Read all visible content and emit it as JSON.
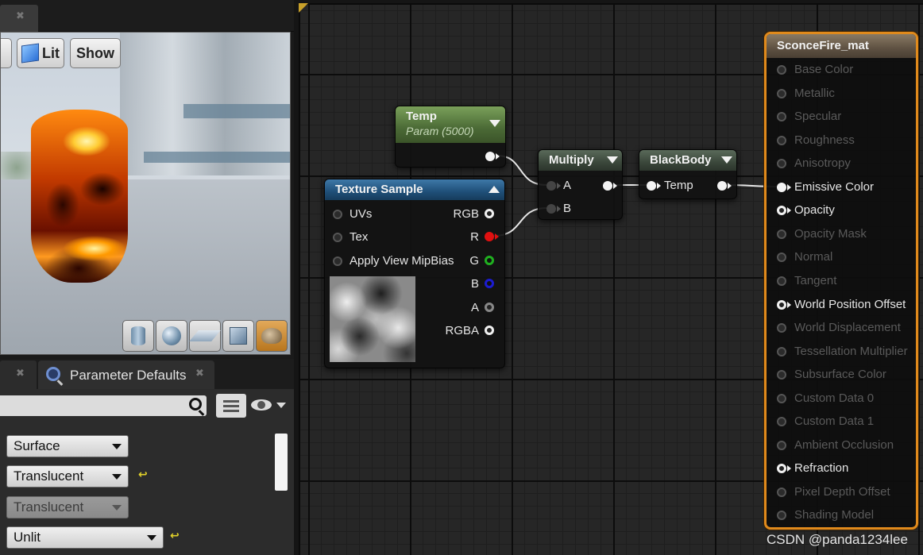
{
  "viewport": {
    "lit_label": "Lit",
    "show_label": "Show"
  },
  "panel": {
    "tab_title": "Parameter Defaults",
    "dropdowns": [
      "Surface",
      "Translucent",
      "Translucent",
      "Unlit"
    ]
  },
  "nodes": {
    "temp": {
      "title": "Temp",
      "subtitle": "Param (5000)"
    },
    "texture": {
      "title": "Texture Sample",
      "inputs": [
        "UVs",
        "Tex",
        "Apply View MipBias"
      ],
      "outputs": [
        "RGB",
        "R",
        "G",
        "B",
        "A",
        "RGBA"
      ]
    },
    "multiply": {
      "title": "Multiply",
      "inputs": [
        "A",
        "B"
      ]
    },
    "blackbody": {
      "title": "BlackBody",
      "input": "Temp"
    },
    "material": {
      "title": "SconceFire_mat",
      "pins": [
        "Base Color",
        "Metallic",
        "Specular",
        "Roughness",
        "Anisotropy",
        "Emissive Color",
        "Opacity",
        "Opacity Mask",
        "Normal",
        "Tangent",
        "World Position Offset",
        "World Displacement",
        "Tessellation Multiplier",
        "Subsurface Color",
        "Custom Data 0",
        "Custom Data 1",
        "Ambient Occlusion",
        "Refraction",
        "Pixel Depth Offset",
        "Shading Model"
      ],
      "active_pins": [
        "Emissive Color",
        "Opacity",
        "World Position Offset",
        "Refraction"
      ]
    }
  },
  "watermark": "CSDN @panda1234lee",
  "colors": {
    "accent": "#e08a1c",
    "pin_r": "#e01010",
    "pin_g": "#20b020",
    "pin_b": "#1c1cd0"
  }
}
